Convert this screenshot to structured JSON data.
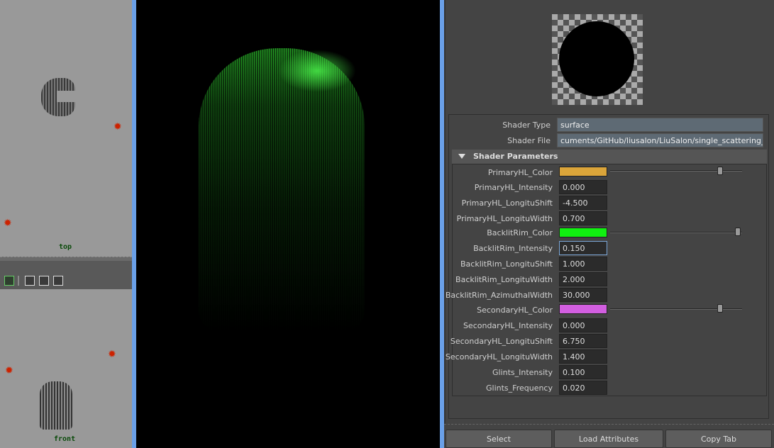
{
  "viewports": {
    "top_label": "top",
    "front_label": "front"
  },
  "shader": {
    "type_label": "Shader Type",
    "type_value": "surface",
    "file_label": "Shader File",
    "file_value": "cuments/GitHub/liusalon/LiuSalon/single_scattering_AFC.sdl"
  },
  "section": {
    "title": "Shader Parameters"
  },
  "params": {
    "primary_color": {
      "label": "PrimaryHL_Color",
      "color": "#dba53a",
      "slider": 0.72
    },
    "primary_intensity": {
      "label": "PrimaryHL_Intensity",
      "value": "0.000"
    },
    "primary_shift": {
      "label": "PrimaryHL_LongituShift",
      "value": "-4.500"
    },
    "primary_width": {
      "label": "PrimaryHL_LongituWidth",
      "value": "0.700"
    },
    "backlit_color": {
      "label": "BacklitRim_Color",
      "color": "#11f011",
      "slider": 0.96
    },
    "backlit_intensity": {
      "label": "BacklitRim_Intensity",
      "value": "0.150"
    },
    "backlit_shift": {
      "label": "BacklitRim_LongituShift",
      "value": "1.000"
    },
    "backlit_width": {
      "label": "BacklitRim_LongituWidth",
      "value": "2.000"
    },
    "backlit_azimuthal": {
      "label": "BacklitRim_AzimuthalWidth",
      "value": "30.000"
    },
    "secondary_color": {
      "label": "SecondaryHL_Color",
      "color": "#d25ee0",
      "slider": 0.72
    },
    "secondary_intensity": {
      "label": "SecondaryHL_Intensity",
      "value": "0.000"
    },
    "secondary_shift": {
      "label": "SecondaryHL_LongituShift",
      "value": "6.750"
    },
    "secondary_width": {
      "label": "SecondaryHL_LongituWidth",
      "value": "1.400"
    },
    "glints_intensity": {
      "label": "Glints_Intensity",
      "value": "0.100"
    },
    "glints_frequency": {
      "label": "Glints_Frequency",
      "value": "0.020"
    }
  },
  "buttons": {
    "select": "Select",
    "load": "Load Attributes",
    "copy": "Copy Tab"
  },
  "icons": {
    "light": "light-marker-icon",
    "select_tool": "select-tool-icon",
    "cube": "cube-icon",
    "copy": "copy-icon",
    "share": "share-icon"
  }
}
